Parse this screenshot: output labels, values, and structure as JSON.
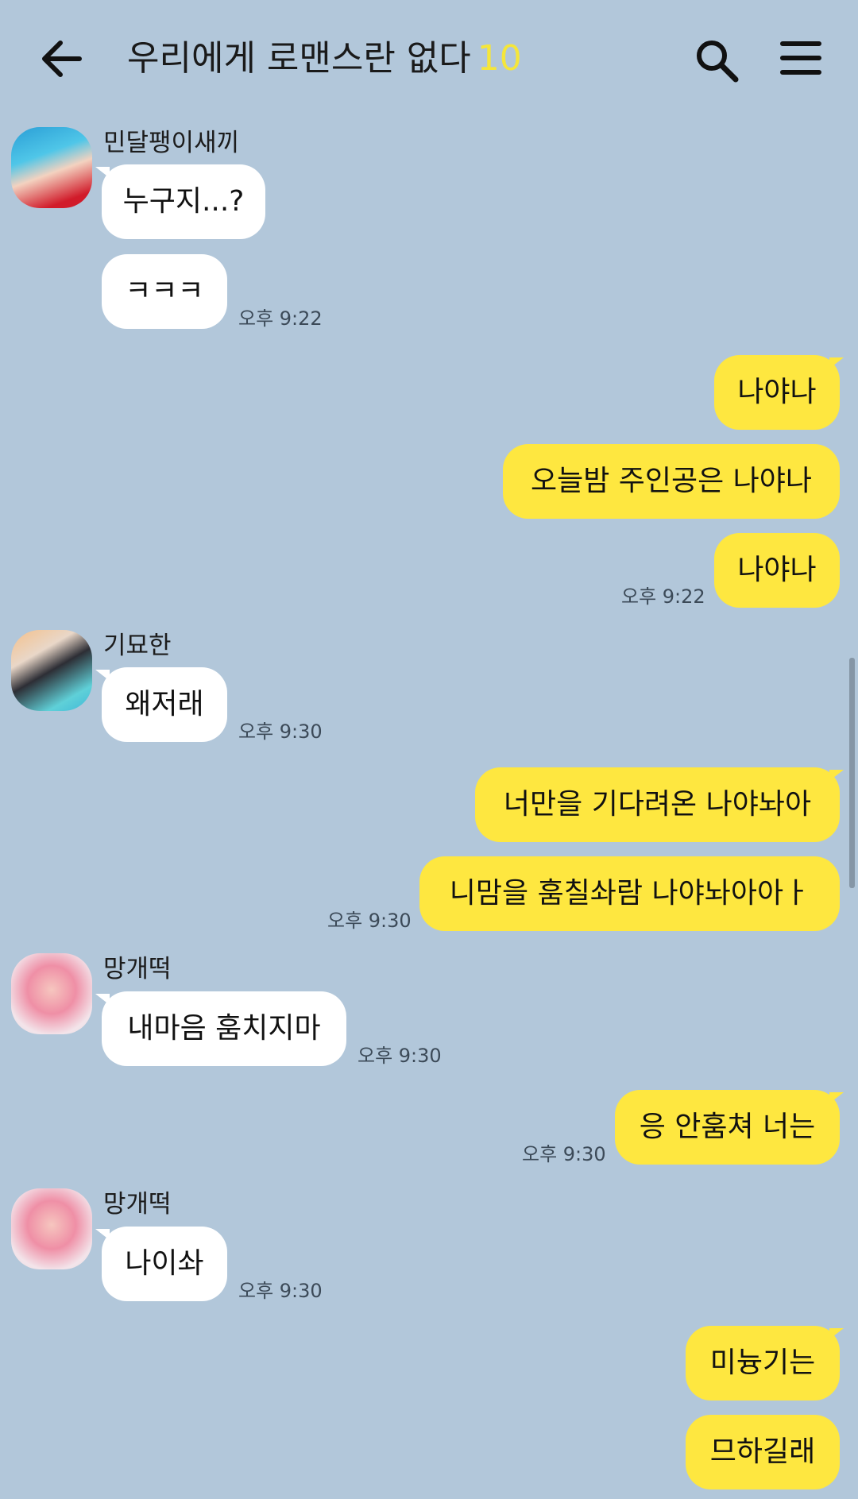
{
  "header": {
    "title": "우리에게 로맨스란 없다",
    "member_count": "10",
    "back_icon": "arrow-left-icon",
    "search_icon": "search-icon",
    "menu_icon": "hamburger-menu-icon"
  },
  "colors": {
    "background": "#b2c7da",
    "my_bubble": "#fee740",
    "their_bubble": "#ffffff",
    "count": "#f5e63a"
  },
  "messages": [
    {
      "sender": "민달팽이새끼",
      "text": "누구지...?"
    },
    {
      "sender": "민달팽이새끼",
      "text": "ㅋㅋㅋ",
      "time": "오후 9:22"
    },
    {
      "sender": "me",
      "text": "나야나"
    },
    {
      "sender": "me",
      "text": "오늘밤 주인공은 나야나"
    },
    {
      "sender": "me",
      "text": "나야나",
      "time": "오후 9:22"
    },
    {
      "sender": "기묘한",
      "text": "왜저래",
      "time": "오후 9:30"
    },
    {
      "sender": "me",
      "text": "너만을 기다려온 나야놔아"
    },
    {
      "sender": "me",
      "text": "니맘을 훔칠솨람 나야놔아아ㅏ",
      "time": "오후 9:30"
    },
    {
      "sender": "망개떡",
      "text": "내마음 훔치지마",
      "time": "오후 9:30"
    },
    {
      "sender": "me",
      "text": "응 안훔쳐 너는",
      "time": "오후 9:30"
    },
    {
      "sender": "망개떡",
      "text": "나이솨",
      "time": "오후 9:30"
    },
    {
      "sender": "me",
      "text": "미늉기는"
    },
    {
      "sender": "me",
      "text": "므하길래"
    }
  ]
}
